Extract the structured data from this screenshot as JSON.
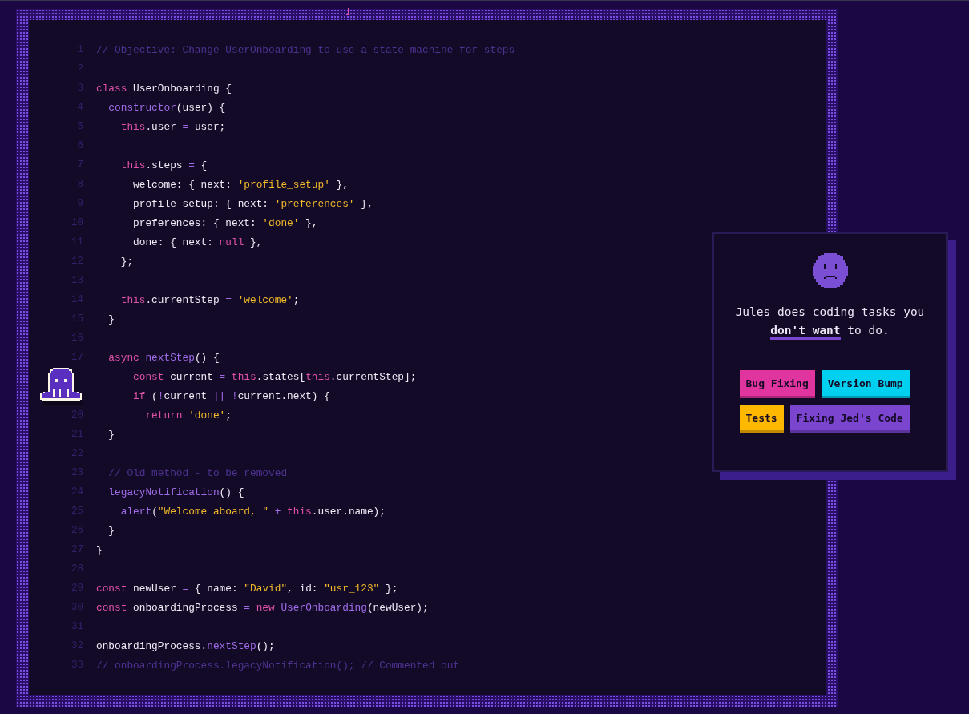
{
  "editor": {
    "lines": [
      {
        "number": "1",
        "tokens": [
          {
            "kind": "comment",
            "text": "// Objective: Change UserOnboarding to use a state machine for steps"
          }
        ]
      },
      {
        "number": "2"
      },
      {
        "number": "3",
        "tokens": [
          {
            "kind": "keyword",
            "text": "class"
          },
          {
            "kind": "plain",
            "text": " UserOnboarding {"
          }
        ]
      },
      {
        "number": "4",
        "tokens": [
          {
            "kind": "function",
            "text": "  constructor"
          },
          {
            "kind": "plain",
            "text": "(user) {"
          }
        ]
      },
      {
        "number": "5",
        "tokens": [
          {
            "kind": "keyword",
            "text": "    this"
          },
          {
            "kind": "plain",
            "text": ".user "
          },
          {
            "kind": "operator",
            "text": "="
          },
          {
            "kind": "plain",
            "text": " user;"
          }
        ]
      },
      {
        "number": "6"
      },
      {
        "number": "7",
        "tokens": [
          {
            "kind": "keyword",
            "text": "    this"
          },
          {
            "kind": "plain",
            "text": ".steps "
          },
          {
            "kind": "operator",
            "text": "="
          },
          {
            "kind": "plain",
            "text": " {"
          }
        ]
      },
      {
        "number": "8",
        "tokens": [
          {
            "kind": "plain",
            "text": "      welcome: { next: "
          },
          {
            "kind": "string",
            "text": "'profile_setup'"
          },
          {
            "kind": "plain",
            "text": " },"
          }
        ]
      },
      {
        "number": "9",
        "tokens": [
          {
            "kind": "plain",
            "text": "      profile_setup: { next: "
          },
          {
            "kind": "string",
            "text": "'preferences'"
          },
          {
            "kind": "plain",
            "text": " },"
          }
        ]
      },
      {
        "number": "10",
        "tokens": [
          {
            "kind": "plain",
            "text": "      preferences: { next: "
          },
          {
            "kind": "string",
            "text": "'done'"
          },
          {
            "kind": "plain",
            "text": " },"
          }
        ]
      },
      {
        "number": "11",
        "tokens": [
          {
            "kind": "plain",
            "text": "      done: { next: "
          },
          {
            "kind": "keyword",
            "text": "null"
          },
          {
            "kind": "plain",
            "text": " },"
          }
        ]
      },
      {
        "number": "12",
        "tokens": [
          {
            "kind": "plain",
            "text": "    };"
          }
        ]
      },
      {
        "number": "13"
      },
      {
        "number": "14",
        "tokens": [
          {
            "kind": "keyword",
            "text": "    this"
          },
          {
            "kind": "plain",
            "text": ".currentStep "
          },
          {
            "kind": "operator",
            "text": "="
          },
          {
            "kind": "string",
            "text": " 'welcome'"
          },
          {
            "kind": "plain",
            "text": ";"
          }
        ]
      },
      {
        "number": "15",
        "tokens": [
          {
            "kind": "plain",
            "text": "  }"
          }
        ]
      },
      {
        "number": "16"
      },
      {
        "number": "17",
        "tokens": [
          {
            "kind": "keyword",
            "text": "  async"
          },
          {
            "kind": "function",
            "text": " nextStep"
          },
          {
            "kind": "plain",
            "text": "() {"
          }
        ]
      },
      {
        "tokens": [
          {
            "kind": "keyword",
            "text": "      const"
          },
          {
            "kind": "plain",
            "text": " current "
          },
          {
            "kind": "operator",
            "text": "="
          },
          {
            "kind": "keyword",
            "text": " this"
          },
          {
            "kind": "plain",
            "text": ".states["
          },
          {
            "kind": "keyword",
            "text": "this"
          },
          {
            "kind": "plain",
            "text": ".currentStep];"
          }
        ]
      },
      {
        "tokens": [
          {
            "kind": "keyword",
            "text": "      if"
          },
          {
            "kind": "plain",
            "text": " ("
          },
          {
            "kind": "operator",
            "text": "!"
          },
          {
            "kind": "plain",
            "text": "current "
          },
          {
            "kind": "operator",
            "text": "|| !"
          },
          {
            "kind": "plain",
            "text": "current.next) {"
          }
        ]
      },
      {
        "number": "20",
        "tokens": [
          {
            "kind": "keyword",
            "text": "        return"
          },
          {
            "kind": "string",
            "text": " 'done'"
          },
          {
            "kind": "plain",
            "text": ";"
          }
        ]
      },
      {
        "number": "21",
        "tokens": [
          {
            "kind": "plain",
            "text": "  }"
          }
        ]
      },
      {
        "number": "22"
      },
      {
        "number": "23",
        "tokens": [
          {
            "kind": "comment",
            "text": "  // Old method - to be removed"
          }
        ]
      },
      {
        "number": "24",
        "tokens": [
          {
            "kind": "function",
            "text": "  legacyNotification"
          },
          {
            "kind": "plain",
            "text": "() {"
          }
        ]
      },
      {
        "number": "25",
        "tokens": [
          {
            "kind": "function",
            "text": "    alert"
          },
          {
            "kind": "plain",
            "text": "("
          },
          {
            "kind": "string",
            "text": "\"Welcome aboard, \""
          },
          {
            "kind": "operator",
            "text": " +"
          },
          {
            "kind": "keyword",
            "text": " this"
          },
          {
            "kind": "plain",
            "text": ".user.name);"
          }
        ]
      },
      {
        "number": "26",
        "tokens": [
          {
            "kind": "plain",
            "text": "  }"
          }
        ]
      },
      {
        "number": "27",
        "tokens": [
          {
            "kind": "plain",
            "text": "}"
          }
        ]
      },
      {
        "number": "28"
      },
      {
        "number": "29",
        "tokens": [
          {
            "kind": "keyword",
            "text": "const"
          },
          {
            "kind": "plain",
            "text": " newUser "
          },
          {
            "kind": "operator",
            "text": "="
          },
          {
            "kind": "plain",
            "text": " { name: "
          },
          {
            "kind": "string",
            "text": "\"David\""
          },
          {
            "kind": "plain",
            "text": ", id: "
          },
          {
            "kind": "string",
            "text": "\"usr_123\""
          },
          {
            "kind": "plain",
            "text": " };"
          }
        ]
      },
      {
        "number": "30",
        "tokens": [
          {
            "kind": "keyword",
            "text": "const"
          },
          {
            "kind": "plain",
            "text": " onboardingProcess "
          },
          {
            "kind": "operator",
            "text": "="
          },
          {
            "kind": "keyword",
            "text": " new"
          },
          {
            "kind": "function",
            "text": " UserOnboarding"
          },
          {
            "kind": "plain",
            "text": "(newUser);"
          }
        ]
      },
      {
        "number": "31"
      },
      {
        "number": "32",
        "tokens": [
          {
            "kind": "plain",
            "text": "onboardingProcess."
          },
          {
            "kind": "function",
            "text": "nextStep"
          },
          {
            "kind": "plain",
            "text": "();"
          }
        ]
      },
      {
        "number": "33",
        "tokens": [
          {
            "kind": "comment",
            "text": "// onboardingProcess.legacyNotification(); // Commented out"
          }
        ]
      }
    ]
  },
  "card": {
    "message": "Jules does coding tasks you **don't want** to do.",
    "tags": [
      {
        "label": "Bug Fixing",
        "color": "#e0359f"
      },
      {
        "label": "Version Bump",
        "color": "#00d0ef"
      },
      {
        "label": "Tests",
        "color": "#ffb800"
      },
      {
        "label": "Fixing Jed's Code",
        "color": "#7b45d0"
      }
    ]
  }
}
